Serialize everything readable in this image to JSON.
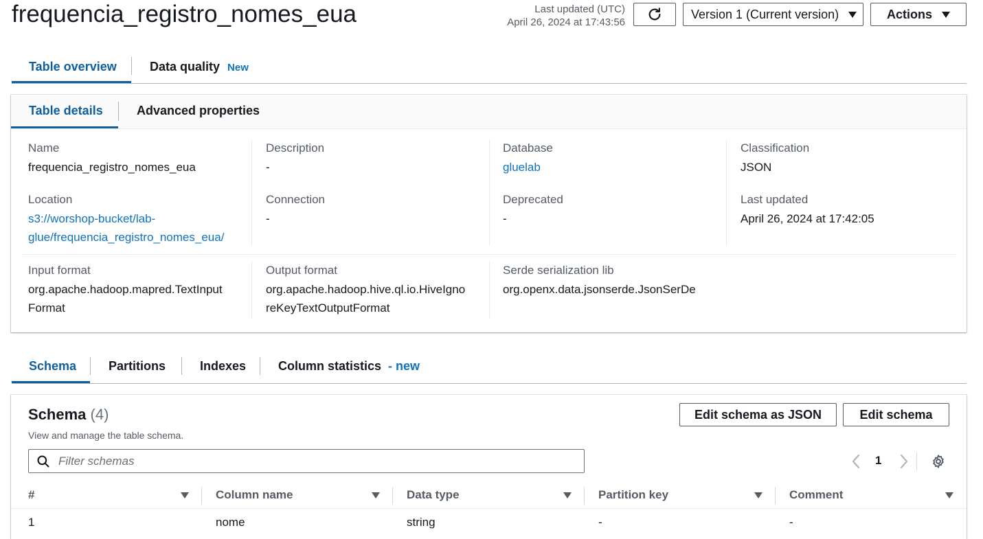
{
  "header": {
    "title": "frequencia_registro_nomes_eua",
    "last_updated_label": "Last updated (UTC)",
    "last_updated_value": "April 26, 2024 at 17:43:56",
    "version_label": "Version 1 (Current version)",
    "actions_label": "Actions"
  },
  "top_tabs": [
    {
      "label": "Table overview"
    },
    {
      "label": "Data quality",
      "badge": "New"
    }
  ],
  "details_tabs": [
    {
      "label": "Table details"
    },
    {
      "label": "Advanced properties"
    }
  ],
  "details": {
    "name": {
      "label": "Name",
      "value": "frequencia_registro_nomes_eua"
    },
    "description": {
      "label": "Description",
      "value": "-"
    },
    "database": {
      "label": "Database",
      "value": "gluelab"
    },
    "classification": {
      "label": "Classification",
      "value": "JSON"
    },
    "location": {
      "label": "Location",
      "value_line1": "s3://worshop-bucket/lab-",
      "value_line2": "glue/frequencia_registro_nomes_eua/"
    },
    "connection": {
      "label": "Connection",
      "value": "-"
    },
    "deprecated": {
      "label": "Deprecated",
      "value": "-"
    },
    "last_updated": {
      "label": "Last updated",
      "value": "April 26, 2024 at 17:42:05"
    },
    "input_format": {
      "label": "Input format",
      "value_line1": "org.apache.hadoop.mapred.TextInput",
      "value_line2": "Format"
    },
    "output_format": {
      "label": "Output format",
      "value_line1": "org.apache.hadoop.hive.ql.io.HiveIgno",
      "value_line2": "reKeyTextOutputFormat"
    },
    "serde": {
      "label": "Serde serialization lib",
      "value": "org.openx.data.jsonserde.JsonSerDe"
    }
  },
  "schema_tabs": [
    {
      "label": "Schema"
    },
    {
      "label": "Partitions"
    },
    {
      "label": "Indexes"
    },
    {
      "label": "Column statistics",
      "badge": "- new"
    }
  ],
  "schema": {
    "title": "Schema",
    "count": "(4)",
    "subtitle": "View and manage the table schema.",
    "edit_json_label": "Edit schema as JSON",
    "edit_label": "Edit schema",
    "filter_placeholder": "Filter schemas",
    "page": "1",
    "columns": [
      "#",
      "Column name",
      "Data type",
      "Partition key",
      "Comment"
    ],
    "rows": [
      {
        "num": "1",
        "name": "nome",
        "type": "string",
        "partition": "-",
        "comment": "-"
      }
    ]
  },
  "icons": {
    "refresh": "refresh-icon",
    "search": "search-icon",
    "settings": "gear-icon",
    "prev": "chevron-left-icon",
    "next": "chevron-right-icon"
  },
  "colors": {
    "accent": "#0f5f9e",
    "link": "#0f73bb",
    "text": "#16191f",
    "muted": "#545b64"
  }
}
